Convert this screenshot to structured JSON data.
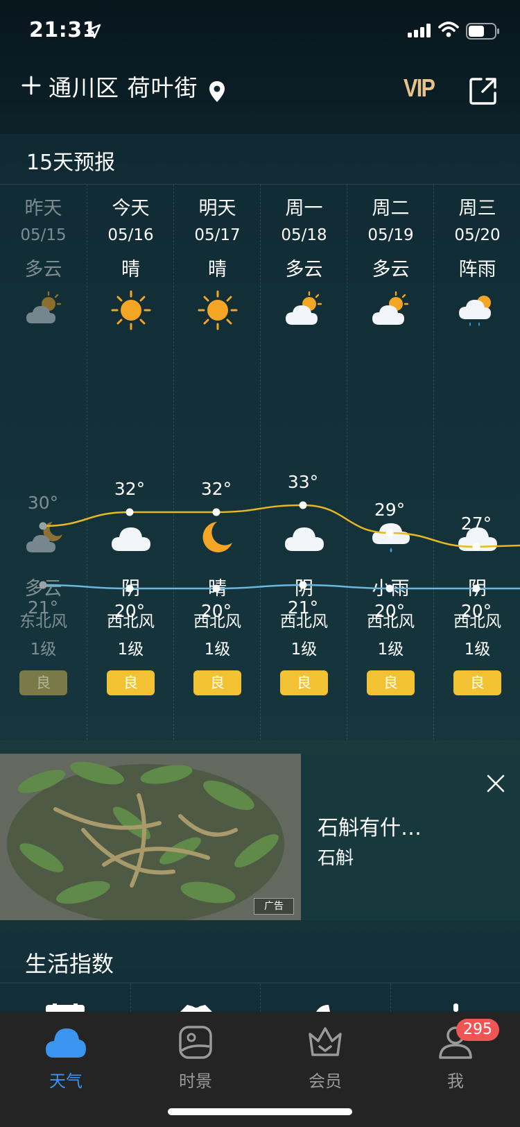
{
  "status": {
    "time": "21:31"
  },
  "header": {
    "location": "通川区 荷叶街",
    "vip": "VIP"
  },
  "forecast": {
    "title": "15天预报",
    "days": [
      {
        "name": "昨天",
        "date": "05/15",
        "day_cond": "多云",
        "day_icon": "partly-cloudy-icon",
        "high": "30°",
        "low": "21°",
        "night_cond": "多云",
        "night_icon": "cloudy-moon-icon",
        "wind_dir": "东北风",
        "wind_level": "1级",
        "aqi": "良"
      },
      {
        "name": "今天",
        "date": "05/16",
        "day_cond": "晴",
        "day_icon": "sun-icon",
        "high": "32°",
        "low": "20°",
        "night_cond": "阴",
        "night_icon": "cloud-icon",
        "wind_dir": "西北风",
        "wind_level": "1级",
        "aqi": "良"
      },
      {
        "name": "明天",
        "date": "05/17",
        "day_cond": "晴",
        "day_icon": "sun-icon",
        "high": "32°",
        "low": "20°",
        "night_cond": "晴",
        "night_icon": "moon-icon",
        "wind_dir": "西北风",
        "wind_level": "1级",
        "aqi": "良"
      },
      {
        "name": "周一",
        "date": "05/18",
        "day_cond": "多云",
        "day_icon": "partly-cloudy-icon",
        "high": "33°",
        "low": "21°",
        "night_cond": "阴",
        "night_icon": "cloud-icon",
        "wind_dir": "西北风",
        "wind_level": "1级",
        "aqi": "良"
      },
      {
        "name": "周二",
        "date": "05/19",
        "day_cond": "多云",
        "day_icon": "partly-cloudy-icon",
        "high": "29°",
        "low": "20°",
        "night_cond": "小雨",
        "night_icon": "light-rain-icon",
        "wind_dir": "西北风",
        "wind_level": "1级",
        "aqi": "良"
      },
      {
        "name": "周三",
        "date": "05/20",
        "day_cond": "阵雨",
        "day_icon": "shower-icon",
        "high": "27°",
        "low": "20°",
        "night_cond": "阴",
        "night_icon": "cloud-icon",
        "wind_dir": "西北风",
        "wind_level": "1级",
        "aqi": "良"
      }
    ],
    "high_values": [
      30,
      32,
      32,
      33,
      29,
      27
    ],
    "low_values": [
      21,
      20,
      20,
      21,
      20,
      20
    ],
    "high_color": "#e8b820",
    "low_color": "#69b8e0"
  },
  "ad": {
    "title": "石斛有什…",
    "subtitle": "石斛",
    "badge": "广告"
  },
  "life": {
    "title": "生活指数"
  },
  "tabs": [
    {
      "label": "天气",
      "icon": "weather-cloud-icon",
      "active": true
    },
    {
      "label": "时景",
      "icon": "scenery-icon",
      "active": false
    },
    {
      "label": "会员",
      "icon": "member-crown-icon",
      "active": false
    },
    {
      "label": "我",
      "icon": "profile-icon",
      "active": false
    }
  ],
  "profile_badge": "295"
}
